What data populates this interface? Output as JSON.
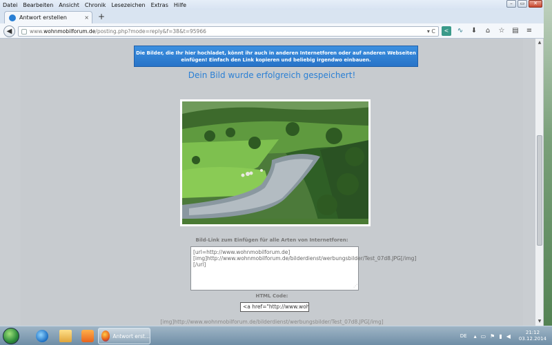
{
  "menubar": {
    "items": [
      {
        "label": "Datei"
      },
      {
        "label": "Bearbeiten"
      },
      {
        "label": "Ansicht"
      },
      {
        "label": "Chronik"
      },
      {
        "label": "Lesezeichen"
      },
      {
        "label": "Extras"
      },
      {
        "label": "Hilfe"
      }
    ]
  },
  "window_controls": {
    "minimize": "–",
    "maximize": "▭",
    "close": "✕"
  },
  "tabs": [
    {
      "label": "Antwort erstellen",
      "close": "×"
    }
  ],
  "new_tab": "+",
  "nav": {
    "back_symbol": "◀",
    "url_domain": "www.wohnmobilforum.de",
    "url_prefix": "www.",
    "url_host": "wohnmobilforum.de",
    "url_path": "/posting.php?mode=reply&f=38&t=95966",
    "url_controls": "▾ C"
  },
  "toolbar_icons": [
    {
      "name": "share-icon",
      "symbol": "<"
    },
    {
      "name": "pocket-icon",
      "symbol": "∿"
    },
    {
      "name": "download-icon",
      "symbol": "⬇"
    },
    {
      "name": "home-icon",
      "symbol": "⌂"
    },
    {
      "name": "bookmark-star-icon",
      "symbol": "☆"
    },
    {
      "name": "clipboard-icon",
      "symbol": "▤"
    },
    {
      "name": "menu-icon",
      "symbol": "≡"
    }
  ],
  "page": {
    "info_line1": "Die Bilder, die Ihr hier hochladet, könnt ihr auch in anderen Internetforen oder auf anderen Webseiten",
    "info_line2": "einfügen! Einfach den Link kopieren und beliebig irgendwo einbauen.",
    "success": "Dein Bild wurde erfolgreich gespeichert!",
    "link_label": "Bild-Link zum Einfügen für alle Arten von Internetforen:",
    "link_text": "[url=http://www.wohnmobilforum.de][img]http://www.wohnmobilforum.de/bilderdienst/werbungsbilder/Test_07d8.JPG[/img][/url]",
    "html_label": "HTML Code:",
    "html_value": "<a href=\"http://www.wohnmobilforum.de\">",
    "bottom_text": "[img]http://www.wohnmobilforum.de/bilderdienst/werbungsbilder/Test_07d8.JPG[/img]"
  },
  "taskbar": {
    "firefox_label": "Antwort erst...",
    "lang": "DE",
    "time": "21:12",
    "date": "03.12.2014"
  }
}
